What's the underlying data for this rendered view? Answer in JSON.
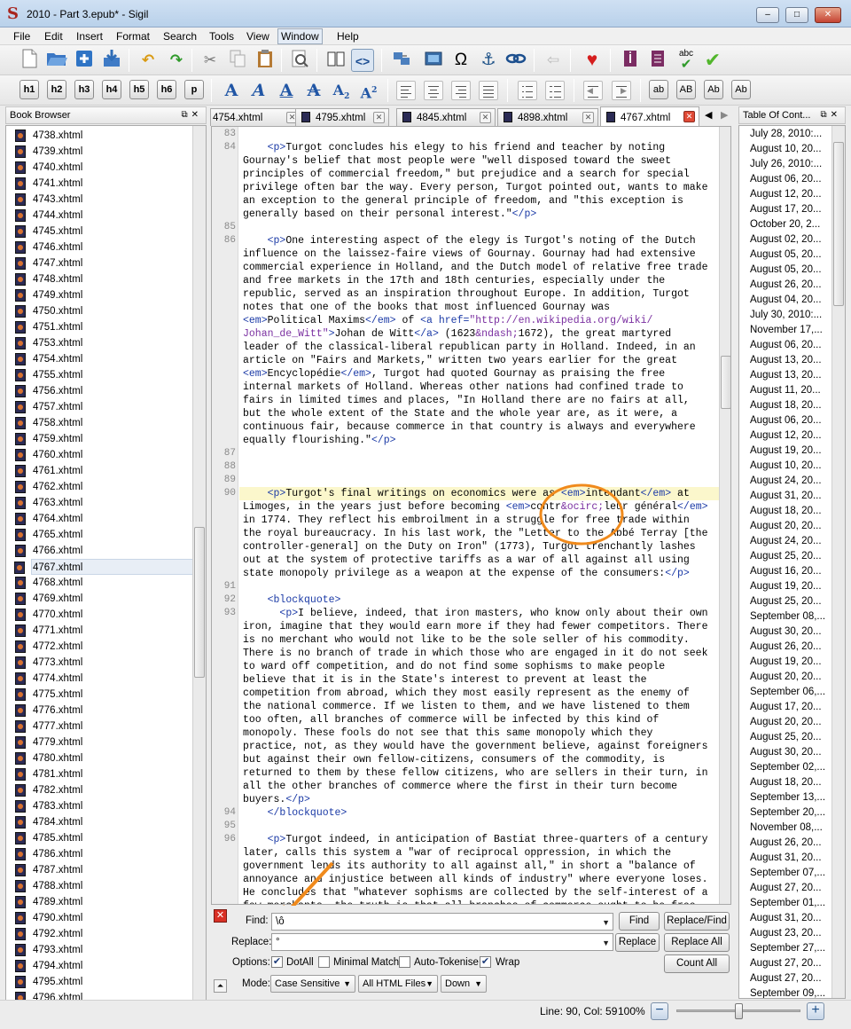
{
  "window": {
    "title": "2010 - Part 3.epub* - Sigil",
    "minimize": "–",
    "maximize": "□",
    "close": "✕"
  },
  "menu": [
    "File",
    "Edit",
    "Insert",
    "Format",
    "Search",
    "Tools",
    "View",
    "Window",
    "Help"
  ],
  "menu_selected": "Window",
  "toolbar1_icons": [
    "new-file-icon",
    "open-folder-icon",
    "add-file-icon",
    "save-icon",
    "undo-icon",
    "redo-icon",
    "cut-icon",
    "copy-icon",
    "paste-icon",
    "meta-preview-icon",
    "book-view-icon",
    "code-view-icon",
    "split-icon",
    "insert-image-icon",
    "special-character-icon",
    "anchor-icon",
    "link-icon",
    "back-arrow-icon",
    "heart-icon",
    "metadata-icon",
    "toc-icon",
    "spellcheck-icon",
    "validate-icon"
  ],
  "headings": [
    "h1",
    "h2",
    "h3",
    "h4",
    "h5",
    "h6",
    "p"
  ],
  "case_buttons": [
    "ab",
    "AB",
    "Ab",
    "Ab"
  ],
  "book_browser": {
    "title": "Book Browser",
    "items": [
      "4738.xhtml",
      "4739.xhtml",
      "4740.xhtml",
      "4741.xhtml",
      "4743.xhtml",
      "4744.xhtml",
      "4745.xhtml",
      "4746.xhtml",
      "4747.xhtml",
      "4748.xhtml",
      "4749.xhtml",
      "4750.xhtml",
      "4751.xhtml",
      "4753.xhtml",
      "4754.xhtml",
      "4755.xhtml",
      "4756.xhtml",
      "4757.xhtml",
      "4758.xhtml",
      "4759.xhtml",
      "4760.xhtml",
      "4761.xhtml",
      "4762.xhtml",
      "4763.xhtml",
      "4764.xhtml",
      "4765.xhtml",
      "4766.xhtml",
      "4767.xhtml",
      "4768.xhtml",
      "4769.xhtml",
      "4770.xhtml",
      "4771.xhtml",
      "4772.xhtml",
      "4773.xhtml",
      "4774.xhtml",
      "4775.xhtml",
      "4776.xhtml",
      "4777.xhtml",
      "4779.xhtml",
      "4780.xhtml",
      "4781.xhtml",
      "4782.xhtml",
      "4783.xhtml",
      "4784.xhtml",
      "4785.xhtml",
      "4786.xhtml",
      "4787.xhtml",
      "4788.xhtml",
      "4789.xhtml",
      "4790.xhtml",
      "4792.xhtml",
      "4793.xhtml",
      "4794.xhtml",
      "4795.xhtml",
      "4796.xhtml"
    ],
    "selected": "4767.xhtml"
  },
  "tabs": [
    {
      "label": "4754.xhtml"
    },
    {
      "label": "4795.xhtml"
    },
    {
      "label": "4845.xhtml"
    },
    {
      "label": "4898.xhtml"
    },
    {
      "label": "4767.xhtml"
    }
  ],
  "active_tab": "4767.xhtml",
  "editor": {
    "lines": [
      {
        "n": "83",
        "html": ""
      },
      {
        "n": "84",
        "html": "    <span class='tag'>&lt;p&gt;</span>Turgot concludes his elegy to his friend and teacher by noting\nGournay's belief that most people were \"well disposed toward the sweet\nprinciples of commercial freedom,\" but prejudice and a search for special\nprivilege often bar the way. Every person, Turgot pointed out, wants to make\nan exception to the general principle of freedom, and \"this exception is\ngenerally based on their personal interest.\"<span class='tag'>&lt;/p&gt;</span>"
      },
      {
        "n": "85",
        "html": ""
      },
      {
        "n": "86",
        "html": "    <span class='tag'>&lt;p&gt;</span>One interesting aspect of the elegy is Turgot's noting of the Dutch\ninfluence on the laissez-faire views of Gournay. Gournay had had extensive\ncommercial experience in Holland, and the Dutch model of relative free trade\nand free markets in the 17th and 18th centuries, especially under the\nrepublic, served as an inspiration throughout Europe. In addition, Turgot\nnotes that one of the books that most influenced Gournay was\n<span class='tag'>&lt;em&gt;</span>Political Maxims<span class='tag'>&lt;/em&gt;</span> of <span class='tag'>&lt;a href=</span><span class='str'>\"http://en.wikipedia.org/wiki/\nJohan_de_Witt\"</span><span class='tag'>&gt;</span>Johan de Witt<span class='tag'>&lt;/a&gt;</span> (1623<span class='ent'>&amp;ndash;</span>1672), the great martyred\nleader of the classical-liberal republican party in Holland. Indeed, in an\narticle on \"Fairs and Markets,\" written two years earlier for the great\n<span class='tag'>&lt;em&gt;</span>Encyclopédie<span class='tag'>&lt;/em&gt;</span>, Turgot had quoted Gournay as praising the free\ninternal markets of Holland. Whereas other nations had confined trade to\nfairs in limited times and places, \"In Holland there are no fairs at all,\nbut the whole extent of the State and the whole year are, as it were, a\ncontinuous fair, because commerce in that country is always and everywhere\nequally flourishing.\"<span class='tag'>&lt;/p&gt;</span>"
      },
      {
        "n": "87",
        "html": ""
      },
      {
        "n": "88",
        "html": ""
      },
      {
        "n": "89",
        "html": ""
      },
      {
        "n": "90",
        "html": "    <span class='tag'>&lt;p&gt;</span>Turgot's final writings on economics were as <span class='tag'>&lt;em&gt;</span>intendant<span class='tag'>&lt;/em&gt;</span> at\nLimoges, in the years just before becoming <span class='tag'>&lt;em&gt;</span>contr<span class='ent'>&amp;ocirc;</span>leur général<span class='tag'>&lt;/em&gt;</span>\nin 1774. They reflect his embroilment in a struggle for free trade within\nthe royal bureaucracy. In his last work, the \"Letter to the Abbé Terray [the\ncontroller-general] on the Duty on Iron\" (1773), Turgot trenchantly lashes\nout at the system of protective tariffs as a war of all against all using\nstate monopoly privilege as a weapon at the expense of the consumers:<span class='tag'>&lt;/p&gt;</span>"
      },
      {
        "n": "91",
        "html": ""
      },
      {
        "n": "92",
        "html": "    <span class='tag'>&lt;blockquote&gt;</span>"
      },
      {
        "n": "93",
        "html": "      <span class='tag'>&lt;p&gt;</span>I believe, indeed, that iron masters, who know only about their own\niron, imagine that they would earn more if they had fewer competitors. There\nis no merchant who would not like to be the sole seller of his commodity.\nThere is no branch of trade in which those who are engaged in it do not seek\nto ward off competition, and do not find some sophisms to make people\nbelieve that it is in the State's interest to prevent at least the\ncompetition from abroad, which they most easily represent as the enemy of\nthe national commerce. If we listen to them, and we have listened to them\ntoo often, all branches of commerce will be infected by this kind of\nmonopoly. These fools do not see that this same monopoly which they\npractice, not, as they would have the government believe, against foreigners\nbut against their own fellow-citizens, consumers of the commodity, is\nreturned to them by these fellow citizens, who are sellers in their turn, in\nall the other branches of commerce where the first in their turn become\nbuyers.<span class='tag'>&lt;/p&gt;</span>"
      },
      {
        "n": "94",
        "html": "    <span class='tag'>&lt;/blockquote&gt;</span>"
      },
      {
        "n": "95",
        "html": ""
      },
      {
        "n": "96",
        "html": "    <span class='tag'>&lt;p&gt;</span>Turgot indeed, in anticipation of Bastiat three-quarters of a century\nlater, calls this system a \"war of reciprocal oppression, in which the\ngovernment lends its authority to all against all,\" in short a \"balance of\nannoyance and injustice between all kinds of industry\" where everyone loses.\nHe concludes that \"whatever sophisms are collected by the self-interest of a\nfew merchants, the truth is that all branches of commerce ought to be free"
      }
    ]
  },
  "find": {
    "find_label": "Find:",
    "find_value": "\\ô",
    "replace_label": "Replace:",
    "replace_value": "°",
    "options_label": "Options:",
    "dotall": "DotAll",
    "minimal": "Minimal Match",
    "autotokenise": "Auto-Tokenise",
    "wrap": "Wrap",
    "mode_label": "Mode:",
    "mode": "Case Sensitive",
    "scope": "All HTML Files",
    "direction": "Down",
    "btn_find": "Find",
    "btn_replace_find": "Replace/Find",
    "btn_replace": "Replace",
    "btn_replace_all": "Replace All",
    "btn_count_all": "Count All"
  },
  "toc": {
    "title": "Table Of Cont...",
    "items": [
      "July 28, 2010:...",
      "August 10, 20...",
      "July 26, 2010:...",
      "August 06, 20...",
      "August 12, 20...",
      "August 17, 20...",
      "October 20, 2...",
      "August 02, 20...",
      "August 05, 20...",
      "August 05, 20...",
      "August 26, 20...",
      "August 04, 20...",
      "July 30, 2010:...",
      "November 17,...",
      "August 06, 20...",
      "August 13, 20...",
      "August 13, 20...",
      "August 11, 20...",
      "August 18, 20...",
      "August 06, 20...",
      "August 12, 20...",
      "August 19, 20...",
      "August 10, 20...",
      "August 24, 20...",
      "August 31, 20...",
      "August 18, 20...",
      "August 20, 20...",
      "August 24, 20...",
      "August 25, 20...",
      "August 16, 20...",
      "August 19, 20...",
      "August 25, 20...",
      "September 08,...",
      "August 30, 20...",
      "August 26, 20...",
      "August 19, 20...",
      "August 20, 20...",
      "September 06,...",
      "August 17, 20...",
      "August 20, 20...",
      "August 25, 20...",
      "August 30, 20...",
      "September 02,...",
      "August 18, 20...",
      "September 13,...",
      "September 20,...",
      "November 08,...",
      "August 26, 20...",
      "August 31, 20...",
      "September 07,...",
      "August 27, 20...",
      "September 01,...",
      "August 31, 20...",
      "August 23, 20...",
      "September 27,...",
      "August 27, 20...",
      "August 27, 20...",
      "September 09,..."
    ]
  },
  "status": {
    "position": "Line: 90, Col: 59",
    "zoom": "100%",
    "zoom_level": 0.5
  }
}
